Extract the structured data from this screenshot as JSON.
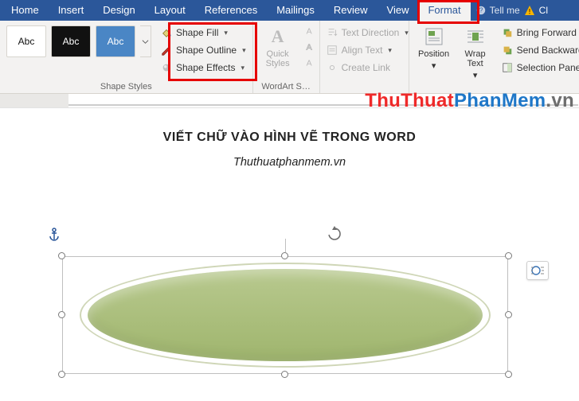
{
  "tabs": {
    "home": "Home",
    "insert": "Insert",
    "design": "Design",
    "layout": "Layout",
    "references": "References",
    "mailings": "Mailings",
    "review": "Review",
    "view": "View",
    "format": "Format",
    "tell_me": "Tell me"
  },
  "ribbon": {
    "shape_styles": {
      "title": "Shape Styles",
      "swatch_label": "Abc",
      "shape_fill": "Shape Fill",
      "shape_outline": "Shape Outline",
      "shape_effects": "Shape Effects"
    },
    "wordart_styles": {
      "title": "WordArt S…",
      "letter": "A",
      "quick_styles": "Quick Styles"
    },
    "text": {
      "text_direction": "Text Direction",
      "align_text": "Align Text",
      "create_link": "Create Link"
    },
    "arrange": {
      "position": "Position",
      "wrap_text": "Wrap Text",
      "bring_forward": "Bring Forward",
      "send_backward": "Send Backward",
      "selection_pane": "Selection Pane"
    }
  },
  "document": {
    "title": "VIẾT CHỮ VÀO HÌNH VẼ TRONG WORD",
    "subtitle": "Thuthuatphanmem.vn"
  },
  "shape": {
    "type": "ellipse",
    "fill": "#aebf80",
    "selected": true
  },
  "watermark": {
    "part1": "ThuThuat",
    "part2": "PhanMem",
    "part3": ".vn"
  },
  "c": "Cl"
}
